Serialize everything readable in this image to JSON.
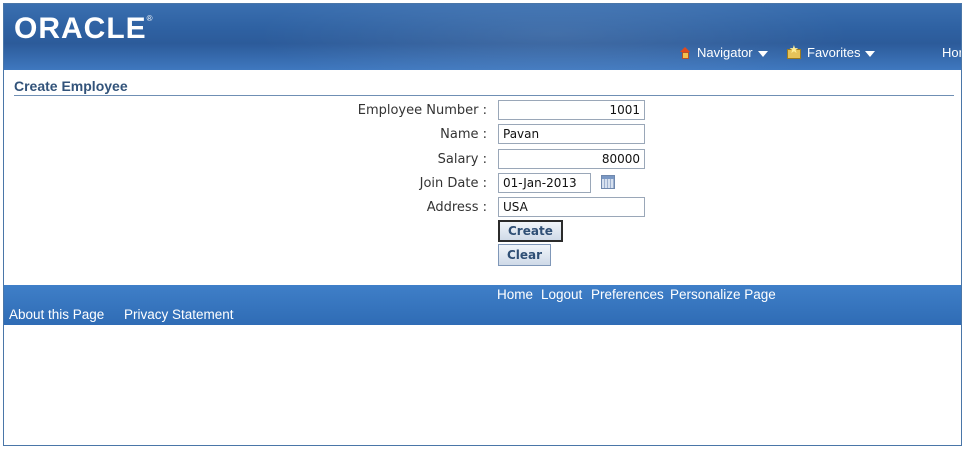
{
  "header": {
    "logo_text": "ORACLE",
    "logo_mark": "®",
    "navigator_label": "Navigator",
    "favorites_label": "Favorites",
    "home_label": "Hor"
  },
  "page": {
    "title": "Create Employee"
  },
  "form": {
    "employee_number": {
      "label": "Employee Number :",
      "value": "1001"
    },
    "name": {
      "label": "Name :",
      "value": "Pavan"
    },
    "salary": {
      "label": "Salary :",
      "value": "80000"
    },
    "join_date": {
      "label": "Join Date :",
      "value": "01-Jan-2013"
    },
    "address": {
      "label": "Address :",
      "value": "USA"
    },
    "create_label": "Create",
    "clear_label": "Clear"
  },
  "footer": {
    "links_top": [
      "Home",
      "Logout",
      "Preferences",
      "Personalize Page"
    ],
    "links_bottom": [
      "About this Page",
      "Privacy Statement"
    ]
  },
  "icons": {
    "navigator": "house-icon",
    "favorites": "favorites-folder-icon",
    "calendar": "calendar-icon",
    "dropdown": "chevron-down-icon"
  },
  "colors": {
    "header_blue": "#2f62a3",
    "footer_blue": "#2f6cb5",
    "title_text": "#32537a"
  }
}
